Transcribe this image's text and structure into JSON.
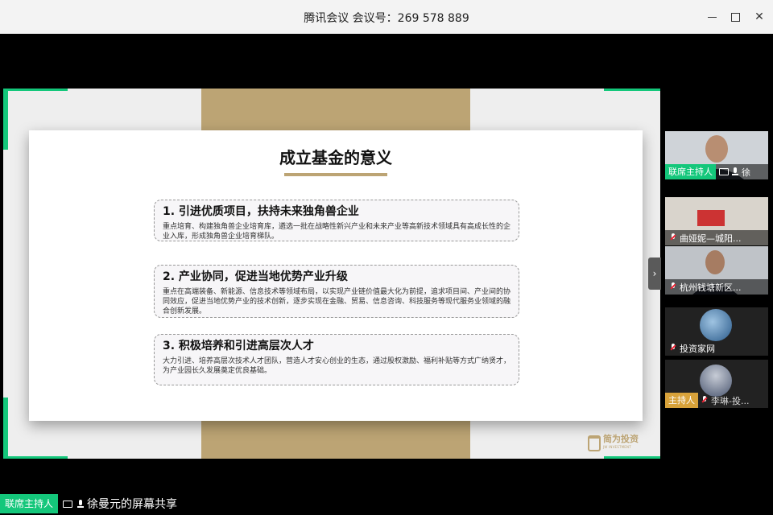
{
  "window": {
    "title": "腾讯会议 会议号：269 578 889"
  },
  "slide": {
    "title": "成立基金的意义",
    "points": [
      {
        "title": "1. 引进优质项目，扶持未来独角兽企业",
        "body": "重点培育、构建独角兽企业培育库，遴选一批在战略性新兴产业和未来产业等高新技术领域具有高成长性的企业入库，形成独角兽企业培育梯队。"
      },
      {
        "title": "2. 产业协同，促进当地优势产业升级",
        "body": "重点在高端装备、新能源、信息技术等领域布局，以实现产业链价值最大化为前提，追求项目间、产业间的协同效应，促进当地优势产业的技术创新，逐步实现在金融、贸易、信息咨询、科技服务等现代服务业领域的融合创新发展。"
      },
      {
        "title": "3. 积极培养和引进高层次人才",
        "body": "大力引进、培养高层次技术人才团队，营造人才安心创业的生态，通过股权激励、福利补贴等方式广纳贤才，为产业园长久发展奠定优良基础。"
      }
    ],
    "logo_text": "简为投资",
    "logo_sub": "JW INVESTMENT"
  },
  "participants": [
    {
      "name": "徐",
      "badge": "联席主持人",
      "sharing": true,
      "muted": false
    },
    {
      "name": "曲娅妮—城阳...",
      "muted": true
    },
    {
      "name": "杭州钱塘新区...",
      "muted": true
    },
    {
      "name": "投资家网",
      "muted": true
    },
    {
      "name": "李琳-投...",
      "badge": "主持人",
      "muted": true
    }
  ],
  "bottom_bar": {
    "host_label": "联席主持人",
    "share_text": "徐曼元的屏幕共享"
  },
  "colors": {
    "accent_green": "#14c77b",
    "gold": "#bca474",
    "host_orange": "#d8a23a"
  }
}
